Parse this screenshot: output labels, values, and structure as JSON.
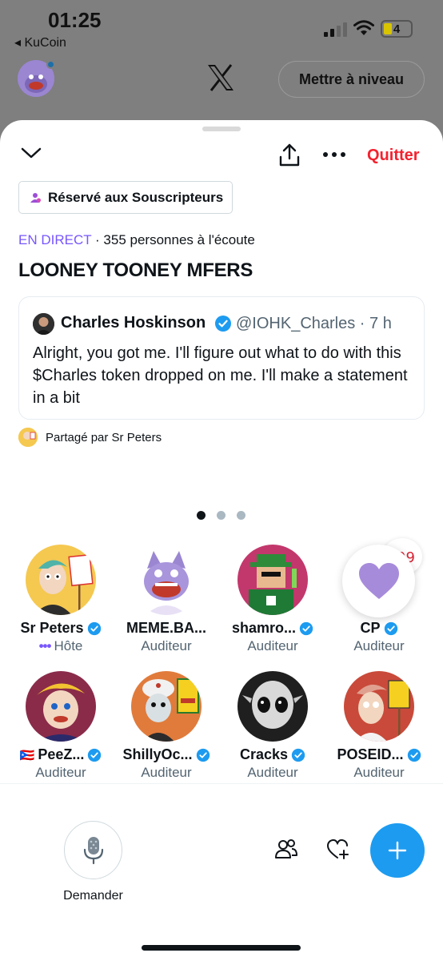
{
  "status_bar": {
    "time": "01:25",
    "back_app": "◂ KuCoin",
    "battery": "4"
  },
  "background": {
    "upgrade_label": "Mettre à niveau"
  },
  "header": {
    "quit_label": "Quitter"
  },
  "space": {
    "badge_label": "Réservé aux Souscripteurs",
    "live_label": "EN DIRECT",
    "listeners_text": " · 355 personnes à l'écoute",
    "title": "LOONEY TOONEY MFERS"
  },
  "tweet": {
    "author": "Charles Hoskinson",
    "handle_time": "@IOHK_Charles · 7 h",
    "text": "Alright, you got me. I'll figure out what to do with this $Charles token dropped on me. I'll make a statement in a bit"
  },
  "shared_by": "Partagé par Sr Peters",
  "pager": {
    "count": 3,
    "active": 0
  },
  "participants": [
    {
      "name": "Sr Peters",
      "role": "Hôte",
      "verified": true,
      "host": true,
      "color": "#f5c850"
    },
    {
      "name": "MEME.BA...",
      "role": "Auditeur",
      "verified": false,
      "host": false,
      "color": "#ffffff"
    },
    {
      "name": "shamro...",
      "role": "Auditeur",
      "verified": true,
      "host": false,
      "color": "#c2386c"
    },
    {
      "name": "CP",
      "role": "Auditeur",
      "verified": true,
      "host": false,
      "color": "#e8e8e8"
    },
    {
      "name": "PeeZ...",
      "role": "Auditeur",
      "verified": true,
      "host": false,
      "flag": "🇵🇷",
      "color": "#d03a3a"
    },
    {
      "name": "ShillyOc...",
      "role": "Auditeur",
      "verified": true,
      "host": false,
      "color": "#e07b3c"
    },
    {
      "name": "Cracks",
      "role": "Auditeur",
      "verified": true,
      "host": false,
      "color": "#2b2b2b"
    },
    {
      "name": "POSEID...",
      "role": "Auditeur",
      "verified": true,
      "host": false,
      "color": "#c94a3a"
    }
  ],
  "controls": {
    "mic_label": "Demander"
  },
  "colors": {
    "accent_blue": "#1d9bf0",
    "live_purple": "#7856ff",
    "quit_red": "#f4212e",
    "reaction_heart": "#a78bdb"
  }
}
